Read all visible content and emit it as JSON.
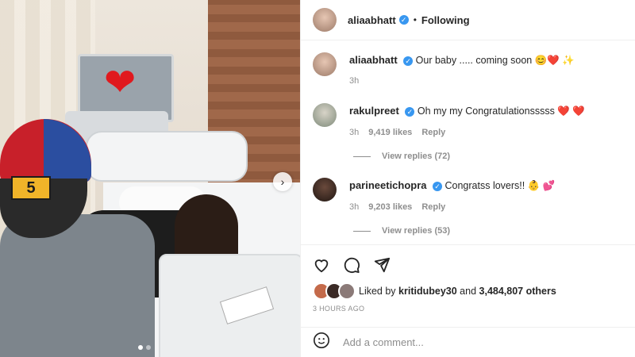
{
  "post": {
    "author": "aliaabhatt",
    "follow_separator": "•",
    "follow_status": "Following",
    "caption_text": "Our baby ..... coming soon",
    "caption_emoji": "😊❤️ ✨",
    "caption_time": "3h",
    "carousel_index": 1,
    "carousel_total": 2,
    "cap_logo_text": "5"
  },
  "comments": [
    {
      "user": "rakulpreet",
      "text": "Oh my my Congratulationsssss",
      "emoji": "❤️ ❤️",
      "time": "3h",
      "likes": "9,419 likes",
      "reply": "Reply",
      "view_replies": "View replies (72)"
    },
    {
      "user": "parineetichopra",
      "text": "Congratss lovers!!",
      "emoji": "👶 💕",
      "time": "3h",
      "likes": "9,203 likes",
      "reply": "Reply",
      "view_replies": "View replies (53)"
    }
  ],
  "likes_bar": {
    "prefix": "Liked by",
    "liker": "kritidubey30",
    "middle": "and",
    "others": "3,484,807 others"
  },
  "timestamp": "3 HOURS AGO",
  "comment_box": {
    "placeholder": "Add a comment..."
  },
  "icons": [
    "heart-icon",
    "comment-icon",
    "share-icon",
    "emoji-icon",
    "verified-icon",
    "chevron-right-icon"
  ]
}
